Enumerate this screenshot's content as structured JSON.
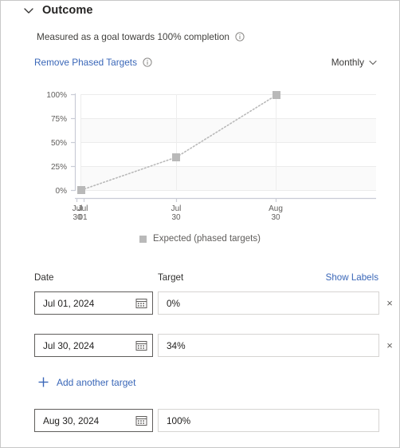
{
  "section": {
    "title": "Outcome",
    "collapse_icon": "chevron-down-icon",
    "measured_text": "Measured as a goal towards 100% completion",
    "measured_info_icon": "info-icon",
    "remove_phased_targets": "Remove Phased Targets",
    "remove_info_icon": "info-icon",
    "frequency": "Monthly",
    "frequency_chevron": "chevron-down-icon"
  },
  "chart_data": {
    "type": "line",
    "title": "",
    "xlabel": "",
    "ylabel": "",
    "ylim": [
      0,
      100
    ],
    "ytick_labels": [
      "100%",
      "75%",
      "50%",
      "25%",
      "0%"
    ],
    "ytick_values": [
      100,
      75,
      50,
      25,
      0
    ],
    "x_tick_labels": [
      {
        "line1": "Jul",
        "line2": "01"
      },
      {
        "line1": "Jul",
        "line2": "30"
      },
      {
        "line1": "Jul",
        "line2": "30"
      },
      {
        "line1": "Aug",
        "line2": "30"
      }
    ],
    "categories": [
      "Jul 01",
      "Jul 30",
      "Aug 30"
    ],
    "series": [
      {
        "name": "Expected (phased targets)",
        "values": [
          0,
          34,
          100
        ],
        "color": "#b9b9b9",
        "line_style": "dotted",
        "marker": "square"
      }
    ],
    "legend": [
      "Expected (phased targets)"
    ],
    "legend_position": "bottom",
    "grid": true
  },
  "legend": {
    "label": "Expected (phased targets)",
    "swatch_color": "#b9b9b9"
  },
  "table": {
    "headers": {
      "date": "Date",
      "target": "Target"
    },
    "show_labels": "Show Labels",
    "calendar_icon": "calendar-icon",
    "remove_icon": "close-icon",
    "rows": [
      {
        "date": "Jul 01, 2024",
        "target": "0%",
        "removable": true
      },
      {
        "date": "Jul 30, 2024",
        "target": "34%",
        "removable": true
      },
      {
        "date": "Aug 30, 2024",
        "target": "100%",
        "removable": false
      }
    ]
  },
  "add_target": {
    "label": "Add another target",
    "icon": "plus-icon"
  }
}
